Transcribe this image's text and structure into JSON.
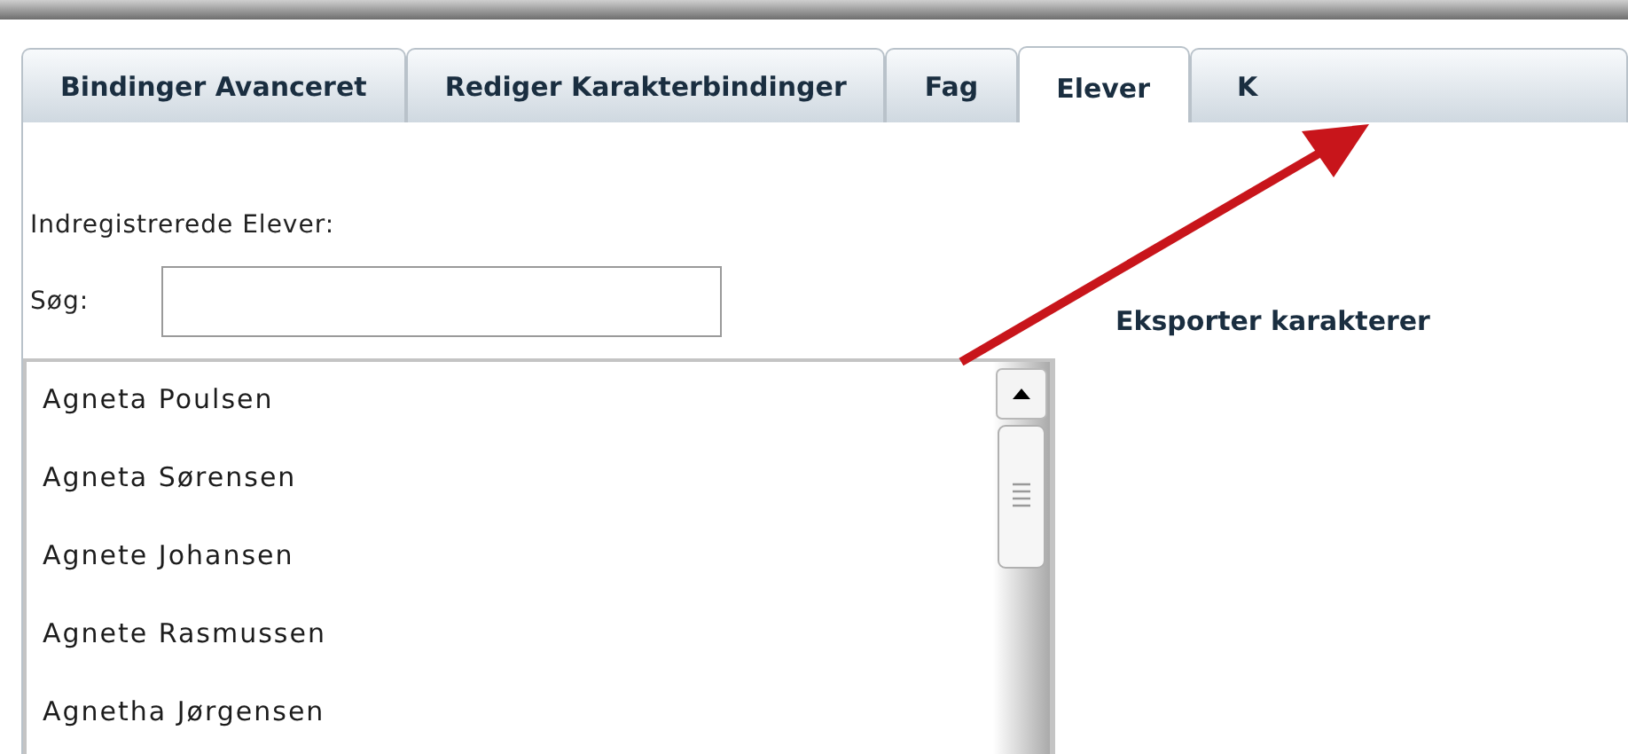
{
  "tabs": [
    {
      "label": "Bindinger Avanceret",
      "selected": false
    },
    {
      "label": "Rediger Karakterbindinger",
      "selected": false
    },
    {
      "label": "Fag",
      "selected": false
    },
    {
      "label": "Elever",
      "selected": true
    },
    {
      "label": "K",
      "selected": false
    }
  ],
  "students_label": "Indregistrerede Elever:",
  "search": {
    "label": "Søg:"
  },
  "students": [
    {
      "name": "Agneta Poulsen"
    },
    {
      "name": "Agneta Sørensen"
    },
    {
      "name": "Agnete Johansen"
    },
    {
      "name": "Agnete Rasmussen"
    },
    {
      "name": "Agnetha Jørgensen"
    }
  ],
  "export_link": "Eksporter karakterer"
}
